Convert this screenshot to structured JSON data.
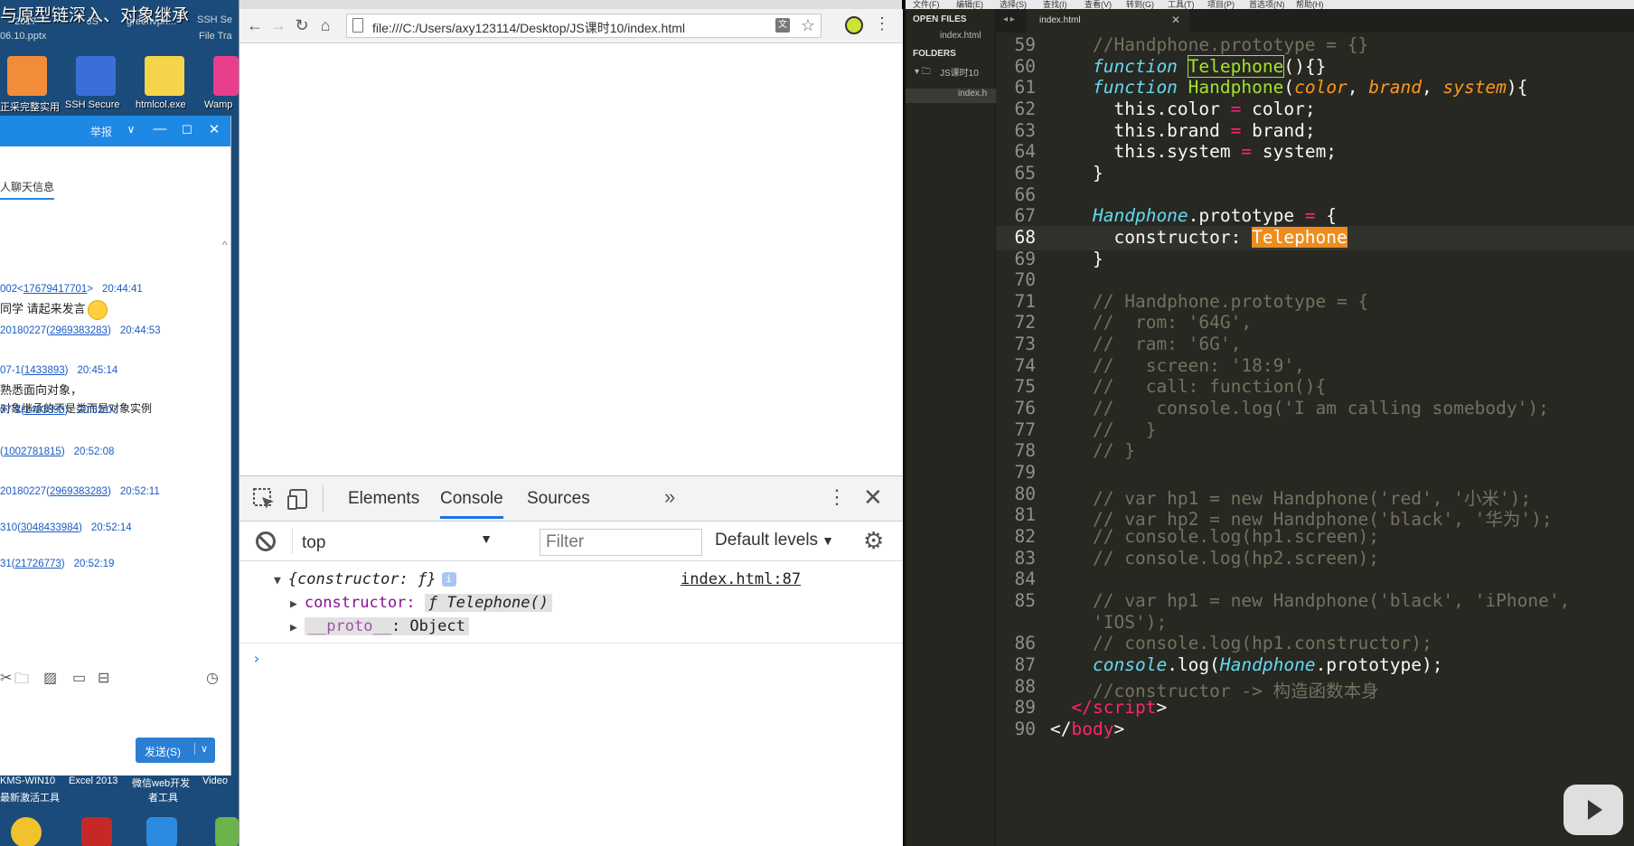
{
  "desktop": {
    "title": "与原型链深入、对象继承",
    "top_labels": [
      "2017",
      "JS",
      "greenvpn...",
      "SSH Se",
      "06.10.pptx",
      "File Tra"
    ],
    "icons": [
      {
        "label": "正采完整实用",
        "name": "photo-app-icon",
        "color": "#f28c38"
      },
      {
        "label": "SSH Secure",
        "name": "ssh-secure-icon",
        "color": "#3b6fd8"
      },
      {
        "label": "htmlcol.exe",
        "name": "htmlcol-icon",
        "color": "#f5d44a"
      },
      {
        "label": "Wamp",
        "name": "wamp-icon",
        "color": "#e83e8c"
      }
    ],
    "taskbar_labels": [
      "KMS-WIN10",
      "Excel 2013",
      "微信web开发",
      "Video",
      "最新激活工具",
      "者工具"
    ],
    "taskbar_icons": [
      {
        "name": "chrome-icon",
        "color": "#f2c12e"
      },
      {
        "name": "filezilla-icon",
        "color": "#c62828"
      },
      {
        "name": "feiq-icon",
        "color": "#2b8be0"
      },
      {
        "name": "misc-app-icon",
        "color": "#6bb34a"
      }
    ]
  },
  "chat": {
    "header_label": "举报",
    "tab_label": "人聊天信息",
    "messages": [
      {
        "prefix": "002<",
        "id": "17679417701",
        "suffix": ">",
        "time": "20:44:41",
        "text": "同学 请起来发言",
        "emoji": true
      },
      {
        "prefix": "20180227(",
        "id": "2969383283",
        "suffix": ")",
        "time": "20:44:53",
        "text": ""
      },
      {
        "prefix": "07-1(",
        "id": "1433893",
        "suffix": ")",
        "time": "20:45:14",
        "text": "熟悉面向对象，",
        "text2": "对象继承的不是类而是对象实例"
      },
      {
        "prefix": "07-1(",
        "id": "1433893",
        "suffix": ")",
        "time": "20:52:07",
        "text": ""
      },
      {
        "prefix": "(",
        "id": "1002781815",
        "suffix": ")",
        "time": "20:52:08",
        "text": ""
      },
      {
        "prefix": "20180227(",
        "id": "2969383283",
        "suffix": ")",
        "time": "20:52:11",
        "text": ""
      },
      {
        "prefix": "310(",
        "id": "3048433984",
        "suffix": ")",
        "time": "20:52:14",
        "text": ""
      },
      {
        "prefix": "31(",
        "id": "21726773",
        "suffix": ")",
        "time": "20:52:19",
        "text": ""
      }
    ],
    "send_label": "发送(S)"
  },
  "browser": {
    "url": "file:///C:/Users/axy123114/Desktop/JS课时10/index.html",
    "devtools": {
      "tabs": [
        "Elements",
        "Console",
        "Sources"
      ],
      "active_tab": "Console",
      "context": "top",
      "filter_placeholder": "Filter",
      "levels": "Default levels",
      "source_link": "index.html:87",
      "log_root": "{constructor: ƒ}",
      "ctor_key": "constructor:",
      "ctor_f": "ƒ",
      "ctor_val": "Telephone()",
      "proto_key": "__proto__",
      "proto_val": ": Object",
      "prompt": "›"
    }
  },
  "editor": {
    "menu": [
      "文件(F)",
      "编辑(E)",
      "选择(S)",
      "查找(I)",
      "查看(V)",
      "转到(G)",
      "工具(T)",
      "项目(P)",
      "首选项(N)",
      "帮助(H)"
    ],
    "open_files_label": "OPEN FILES",
    "open_file": "index.html",
    "folders_label": "FOLDERS",
    "folder": "JS课时10",
    "folder_file": "index.h",
    "tab": "index.html",
    "current_line": "68",
    "lines": [
      {
        "n": "59",
        "html": "<span class='cm'>//Handphone.prototype = {}</span>"
      },
      {
        "n": "60",
        "html": "<span class='k'>function</span> <span class='f box'>Telephone</span>(){}"
      },
      {
        "n": "61",
        "html": "<span class='k'>function</span> <span class='f'>Handphone</span>(<span class='p'>color</span>, <span class='p'>brand</span>, <span class='p'>system</span>){"
      },
      {
        "n": "62",
        "html": "  this.color <span class='o'>=</span> color;"
      },
      {
        "n": "63",
        "html": "  this.brand <span class='o'>=</span> brand;"
      },
      {
        "n": "64",
        "html": "  this.system <span class='o'>=</span> system;"
      },
      {
        "n": "65",
        "html": "}"
      },
      {
        "n": "66",
        "html": ""
      },
      {
        "n": "67",
        "html": "<span class='k'>Handphone</span>.prototype <span class='o'>=</span> {"
      },
      {
        "n": "68",
        "html": "  constructor: <span class='find-hl'>Telephone</span>"
      },
      {
        "n": "69",
        "html": "}"
      },
      {
        "n": "70",
        "html": ""
      },
      {
        "n": "71",
        "html": "<span class='cm'>// Handphone.prototype = {</span>"
      },
      {
        "n": "72",
        "html": "<span class='cm'>//  rom: '64G',</span>"
      },
      {
        "n": "73",
        "html": "<span class='cm'>//  ram: '6G',</span>"
      },
      {
        "n": "74",
        "html": "<span class='cm'>//   screen: '18:9',</span>"
      },
      {
        "n": "75",
        "html": "<span class='cm'>//   call: function(){</span>"
      },
      {
        "n": "76",
        "html": "<span class='cm'>//    console.log('I am calling somebody');</span>"
      },
      {
        "n": "77",
        "html": "<span class='cm'>//   }</span>"
      },
      {
        "n": "78",
        "html": "<span class='cm'>// }</span>"
      },
      {
        "n": "79",
        "html": ""
      },
      {
        "n": "80",
        "html": "<span class='cm'>// var hp1 = new Handphone('red', '小米');</span>"
      },
      {
        "n": "81",
        "html": "<span class='cm'>// var hp2 = new Handphone('black', '华为');</span>"
      },
      {
        "n": "82",
        "html": "<span class='cm'>// console.log(hp1.screen);</span>"
      },
      {
        "n": "83",
        "html": "<span class='cm'>// console.log(hp2.screen);</span>"
      },
      {
        "n": "84",
        "html": ""
      },
      {
        "n": "85",
        "html": "<span class='cm'>// var hp1 = new Handphone('black', 'iPhone',</span>"
      },
      {
        "n": "",
        "html": "<span class='cm'>'IOS');</span>"
      },
      {
        "n": "86",
        "html": "<span class='cm'>// console.log(hp1.constructor);</span>"
      },
      {
        "n": "87",
        "html": "<span class='k'>console</span>.log(<span class='k'>Handphone</span>.prototype);"
      },
      {
        "n": "88",
        "html": "<span class='cm'>//constructor -> 构造函数本身</span>"
      },
      {
        "n": "89",
        "html": "<span class='o'>&lt;/</span><span class='t'>script</span>&gt;"
      },
      {
        "n": "90",
        "html": "&lt;/<span class='t'>body</span>&gt;"
      }
    ],
    "indents": [
      1,
      1,
      1,
      1,
      1,
      1,
      1,
      1,
      1,
      1,
      1,
      1,
      1,
      1,
      1,
      1,
      1,
      1,
      1,
      1,
      1,
      1,
      1,
      1,
      1,
      1,
      1,
      1,
      1,
      1,
      1,
      0,
      -1
    ]
  }
}
